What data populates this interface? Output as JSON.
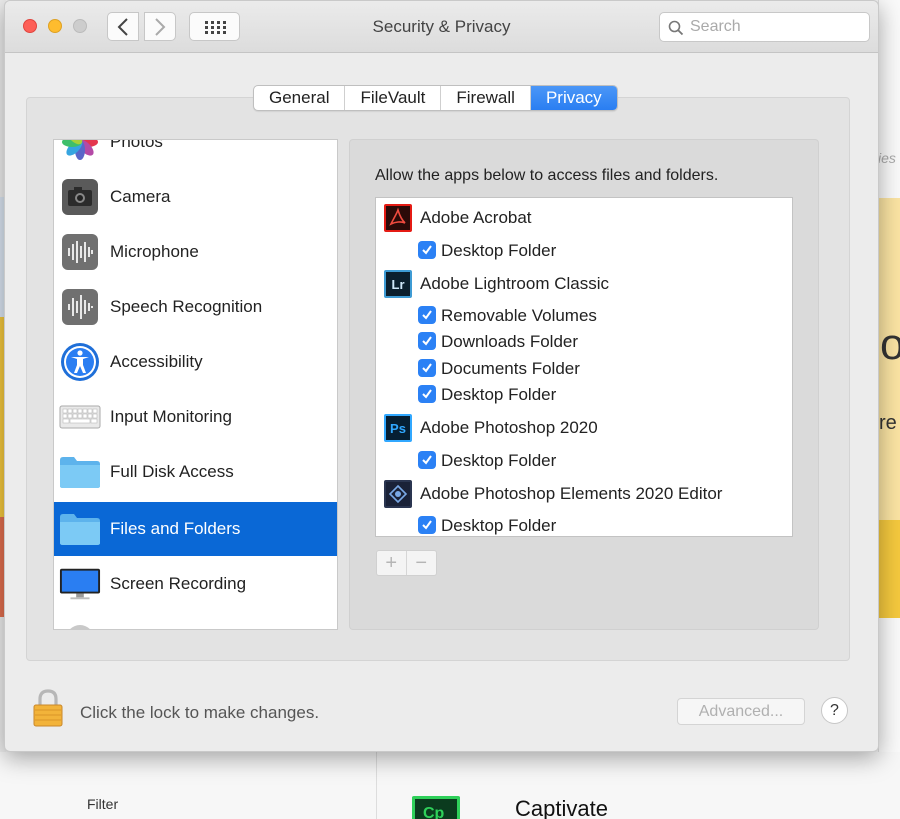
{
  "background": {
    "filter_label": "Filter",
    "captivate_icon_text": "Cp",
    "captivate_label": "Captivate",
    "partial_o": "o",
    "partial_re": "re",
    "partial_ies": "ies"
  },
  "window": {
    "title": "Security & Privacy",
    "search_placeholder": "Search"
  },
  "tabs": [
    {
      "label": "General",
      "active": false
    },
    {
      "label": "FileVault",
      "active": false
    },
    {
      "label": "Firewall",
      "active": false
    },
    {
      "label": "Privacy",
      "active": true
    }
  ],
  "sidebar": {
    "items": [
      {
        "label": "Photos",
        "icon": "photos-icon"
      },
      {
        "label": "Camera",
        "icon": "camera-icon"
      },
      {
        "label": "Microphone",
        "icon": "microphone-icon"
      },
      {
        "label": "Speech Recognition",
        "icon": "speech-recognition-icon"
      },
      {
        "label": "Accessibility",
        "icon": "accessibility-icon"
      },
      {
        "label": "Input Monitoring",
        "icon": "keyboard-icon"
      },
      {
        "label": "Full Disk Access",
        "icon": "folder-icon"
      },
      {
        "label": "Files and Folders",
        "icon": "folder-icon",
        "selected": true
      },
      {
        "label": "Screen Recording",
        "icon": "display-icon"
      },
      {
        "label": "",
        "icon": "gear-icon"
      }
    ]
  },
  "main": {
    "allow_text": "Allow the apps below to access files and folders.",
    "apps": [
      {
        "name": "Adobe Acrobat",
        "icon": "acrobat-icon",
        "permissions": [
          "Desktop Folder"
        ]
      },
      {
        "name": "Adobe Lightroom Classic",
        "icon": "lightroom-icon",
        "icon_text": "Lr",
        "permissions": [
          "Removable Volumes",
          "Downloads Folder",
          "Documents Folder",
          "Desktop Folder"
        ]
      },
      {
        "name": "Adobe Photoshop 2020",
        "icon": "photoshop-icon",
        "icon_text": "Ps",
        "permissions": [
          "Desktop Folder"
        ]
      },
      {
        "name": "Adobe Photoshop Elements 2020 Editor",
        "icon": "photoshop-elements-icon",
        "permissions": [
          "Desktop Folder"
        ]
      }
    ],
    "add_label": "+",
    "remove_label": "−"
  },
  "footer": {
    "lock_text": "Click the lock to make changes.",
    "advanced_label": "Advanced...",
    "help_label": "?"
  },
  "colors": {
    "accent": "#2a7ef2",
    "selection": "#0a68d6",
    "checkbox": "#2b81f5"
  }
}
